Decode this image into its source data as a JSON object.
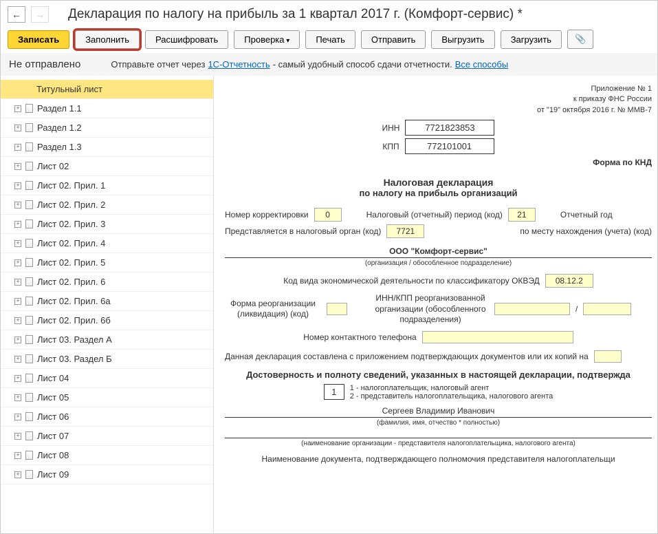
{
  "header": {
    "title": "Декларация по налогу на прибыль за 1 квартал 2017 г. (Комфорт-сервис) *"
  },
  "toolbar": {
    "record": "Записать",
    "fill": "Заполнить",
    "decode": "Расшифровать",
    "check": "Проверка",
    "print": "Печать",
    "send": "Отправить",
    "export": "Выгрузить",
    "import": "Загрузить"
  },
  "status": {
    "not_sent": "Не отправлено",
    "hint_prefix": "Отправьте отчет через ",
    "link1": "1С-Отчетность",
    "hint_suffix": " - самый удобный способ сдачи отчетности. ",
    "link2": "Все способы"
  },
  "sidebar": {
    "items": [
      "Титульный лист",
      "Раздел 1.1",
      "Раздел 1.2",
      "Раздел 1.3",
      "Лист 02",
      "Лист 02. Прил. 1",
      "Лист 02. Прил. 2",
      "Лист 02. Прил. 3",
      "Лист 02. Прил. 4",
      "Лист 02. Прил. 5",
      "Лист 02. Прил. 6",
      "Лист 02. Прил. 6а",
      "Лист 02. Прил. 6б",
      "Лист 03. Раздел А",
      "Лист 03. Раздел Б",
      "Лист 04",
      "Лист 05",
      "Лист 06",
      "Лист 07",
      "Лист 08",
      "Лист 09"
    ]
  },
  "form": {
    "app_line1": "Приложение № 1",
    "app_line2": "к приказу ФНС России",
    "app_line3": "от \"19\" октября 2016 г. № ММВ-7",
    "inn_label": "ИНН",
    "inn": "7721823853",
    "kpp_label": "КПП",
    "kpp": "772101001",
    "knd_label": "Форма по КНД",
    "main_title": "Налоговая декларация",
    "sub_title": "по налогу на прибыль организаций",
    "corr_label": "Номер корректировки",
    "corr": "0",
    "period_label": "Налоговый (отчетный) период (код)",
    "period": "21",
    "year_label": "Отчетный год",
    "tax_org_label": "Представляется в налоговый орган (код)",
    "tax_org": "7721",
    "location_label": "по месту нахождения (учета) (код)",
    "org_name": "ООО \"Комфорт-сервис\"",
    "org_caption": "(организация / обособленное подразделение)",
    "okved_label": "Код вида экономической деятельности по классификатору ОКВЭД",
    "okved": "08.12.2",
    "reorg_label1": "Форма реорганизации",
    "reorg_label2": "(ликвидация) (код)",
    "reorg_inn_label1": "ИНН/КПП реорганизованной",
    "reorg_inn_label2": "организации (обособленного",
    "reorg_inn_label3": "подразделения)",
    "phone_label": "Номер контактного телефона",
    "attach_label": "Данная декларация составлена с приложением подтверждающих документов или их копий на",
    "section_title": "Достоверность и полноту сведений, указанных в настоящей декларации, подтвержда",
    "rep_code": "1",
    "rep_hint1": "1 - налогоплательщик, налоговый агент",
    "rep_hint2": "2 - представитель налогоплательщика, налогового агента",
    "fio": "Сергеев Владимир Иванович",
    "fio_caption": "(фамилия, имя, отчество * полностью)",
    "rep_org_caption": "(наименование организации - представителя налогоплательщика, налогового агента)",
    "doc_label": "Наименование документа, подтверждающего полномочия представителя налогоплательщи"
  }
}
